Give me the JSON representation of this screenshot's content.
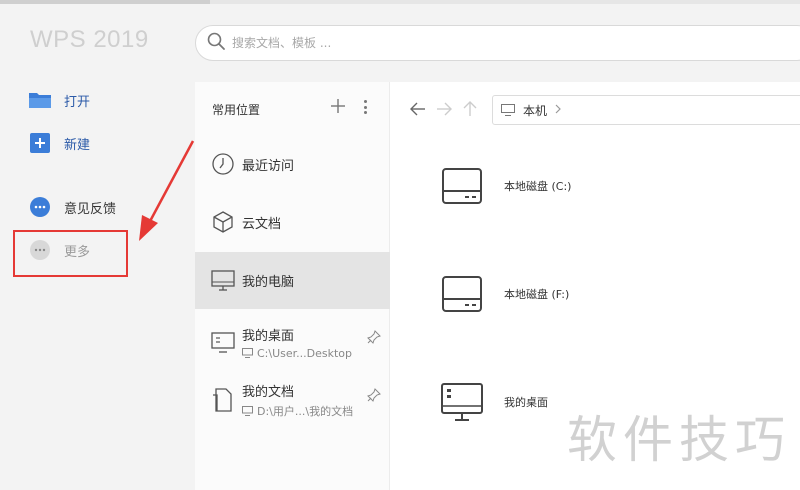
{
  "app": {
    "title": "WPS 2019"
  },
  "search": {
    "placeholder": "搜索文档、模板 ..."
  },
  "nav": {
    "open": "打开",
    "new": "新建",
    "feedback": "意见反馈",
    "more": "更多"
  },
  "places": {
    "header": "常用位置",
    "items": [
      {
        "label": "最近访问",
        "icon": "clock-icon"
      },
      {
        "label": "云文档",
        "icon": "cube-icon"
      },
      {
        "label": "我的电脑",
        "icon": "computer-icon",
        "active": true
      },
      {
        "label": "我的桌面",
        "path": "C:\\User...Desktop",
        "icon": "desktop-icon"
      },
      {
        "label": "我的文档",
        "path": "D:\\用户...\\我的文档",
        "icon": "document-icon"
      }
    ]
  },
  "breadcrumb": {
    "location": "本机"
  },
  "drives": [
    {
      "label": "本地磁盘 (C:)",
      "icon": "hard-drive-icon"
    },
    {
      "label": "本地磁盘 (F:)",
      "icon": "hard-drive-icon"
    },
    {
      "label": "我的桌面",
      "icon": "desktop-folder-icon"
    }
  ],
  "watermark": "软件技巧",
  "colors": {
    "accent": "#2b5aa8",
    "highlight": "#e53935",
    "active_bg": "#e4e4e4"
  }
}
